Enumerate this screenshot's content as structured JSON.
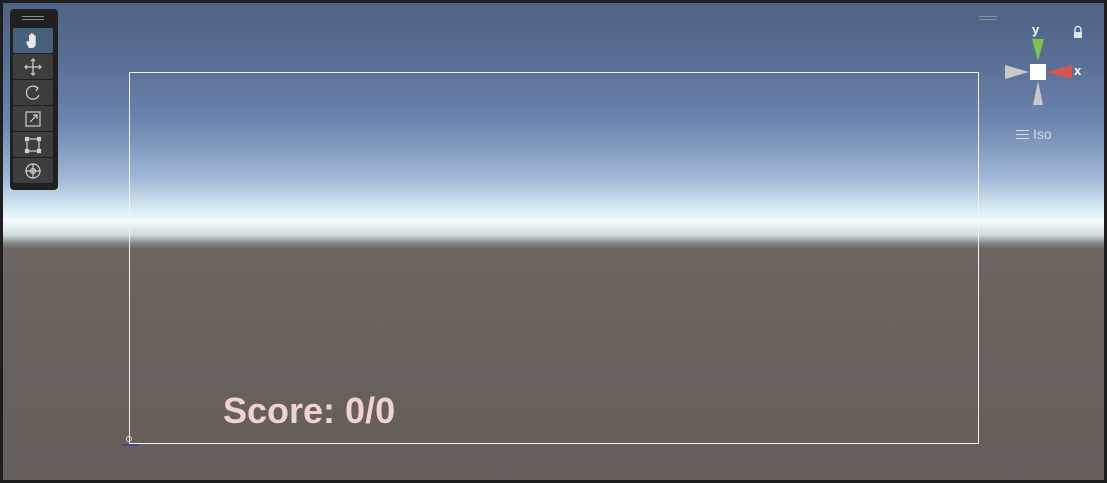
{
  "scene": {
    "tools": [
      {
        "name": "hand",
        "active": true
      },
      {
        "name": "move",
        "active": false
      },
      {
        "name": "rotate",
        "active": false
      },
      {
        "name": "scale",
        "active": false
      },
      {
        "name": "rect",
        "active": false
      },
      {
        "name": "transform",
        "active": false
      }
    ],
    "score_text": "Score: 0/0",
    "gizmo": {
      "y_label": "y",
      "x_label": "x",
      "projection_label": "Iso",
      "y_color": "#7cc44a",
      "x_color": "#d9534f"
    }
  }
}
